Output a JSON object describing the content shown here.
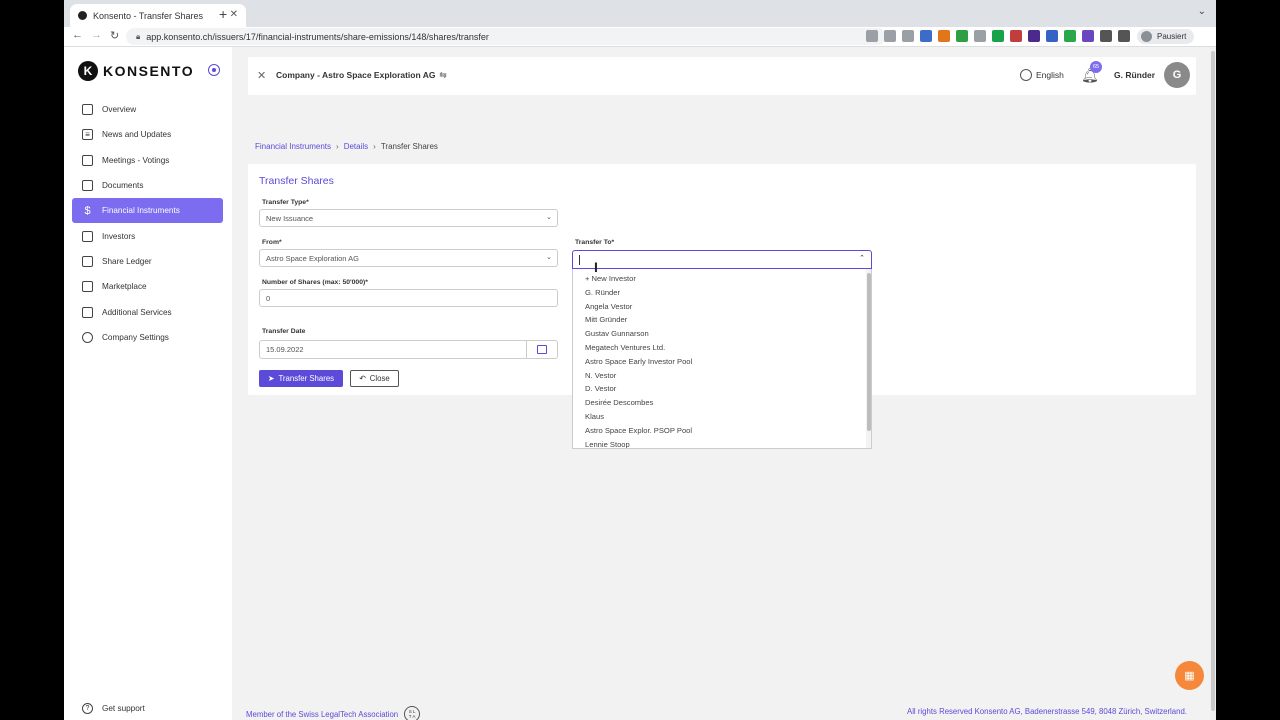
{
  "browser": {
    "tab_title": "Konsento - Transfer Shares",
    "url": "app.konsento.ch/issuers/17/financial-instruments/share-emissions/148/shares/transfer",
    "paused_label": "Pausiert"
  },
  "logo": {
    "text": "KONSENTO"
  },
  "sidebar": {
    "items": [
      {
        "label": "Overview",
        "icon": "home-icon"
      },
      {
        "label": "News and Updates",
        "icon": "list-icon"
      },
      {
        "label": "Meetings - Votings",
        "icon": "video-icon"
      },
      {
        "label": "Documents",
        "icon": "document-icon"
      },
      {
        "label": "Financial Instruments",
        "icon": "dollar-icon",
        "active": true
      },
      {
        "label": "Investors",
        "icon": "users-icon"
      },
      {
        "label": "Share Ledger",
        "icon": "ledger-icon"
      },
      {
        "label": "Marketplace",
        "icon": "bag-icon"
      },
      {
        "label": "Additional Services",
        "icon": "grid-icon"
      },
      {
        "label": "Company Settings",
        "icon": "gear-icon"
      }
    ],
    "support": "Get support"
  },
  "topbar": {
    "company": "Company - Astro Space Exploration AG",
    "language": "English",
    "notifications": "65",
    "user": "G. Ründer",
    "avatar_initial": "G"
  },
  "breadcrumb": {
    "items": [
      "Financial Instruments",
      "Details",
      "Transfer Shares"
    ]
  },
  "form": {
    "title": "Transfer Shares",
    "transfer_type_label": "Transfer Type*",
    "transfer_type_value": "New Issuance",
    "from_label": "From*",
    "from_value": "Astro Space Exploration AG",
    "shares_label": "Number of Shares (max: 50'000)*",
    "shares_value": "0",
    "date_label": "Transfer Date",
    "date_value": "15.09.2022",
    "to_label": "Transfer To*",
    "submit": "Transfer Shares",
    "close": "Close"
  },
  "dropdown_options": [
    "+ New Investor",
    "G. Ründer",
    "Angela Vestor",
    "Mitt Gründer",
    "Gustav Gunnarson",
    "Megatech Ventures Ltd.",
    "Astro Space Early Investor Pool",
    "N. Vestor",
    "D. Vestor",
    "Desirée Descombes",
    "Klaus",
    "Astro Space Explor. PSOP Pool",
    "Lennie Stoop"
  ],
  "footer": {
    "left": "Member of the Swiss LegalTech Association",
    "right": "All rights Reserved Konsento AG, Badenerstrasse 549, 8048 Zürich, Switzerland."
  },
  "colors": {
    "accent": "#5b4bd8",
    "active_nav": "#7c6cf0",
    "fab": "#f5883a"
  }
}
